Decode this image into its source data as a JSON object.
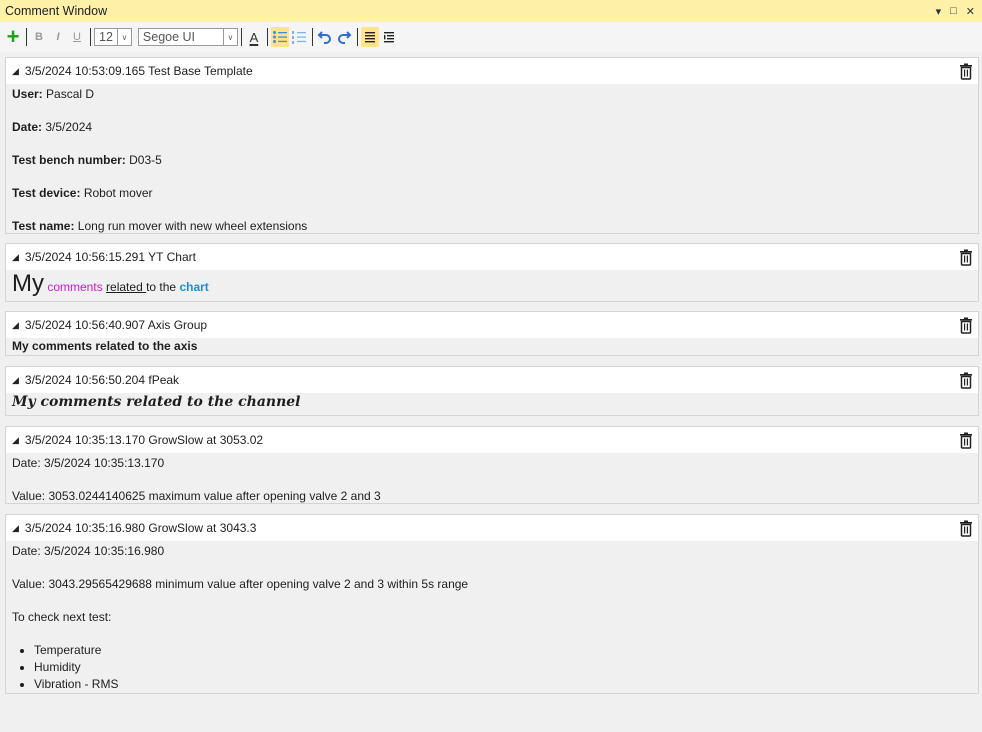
{
  "window": {
    "title": "Comment Window",
    "menu_glyph": "▾",
    "restore_glyph": "□",
    "close_glyph": "✕"
  },
  "toolbar": {
    "add": "+",
    "bold": "B",
    "italic": "I",
    "underline": "U",
    "font_size": "12",
    "font_family": "Segoe UI",
    "font_color": "A",
    "dropdown_glyph": "∨"
  },
  "comments": [
    {
      "header": "3/5/2024 10:53:09.165 Test Base Template",
      "fields": [
        {
          "label": "User:",
          "value": " Pascal D"
        },
        {
          "label": "Date:",
          "value": " 3/5/2024"
        },
        {
          "label": "Test bench number:",
          "value": " D03-5"
        },
        {
          "label": "Test device:",
          "value": " Robot mover"
        },
        {
          "label": "Test name:",
          "value": " Long run mover with new wheel extensions"
        }
      ]
    },
    {
      "header": "3/5/2024 10:56:15.291 YT Chart",
      "rich": {
        "big": "My",
        "comments": "comments",
        "related": "related ",
        "to_the": "to the ",
        "chart": "chart"
      }
    },
    {
      "header": "3/5/2024 10:56:40.907 Axis Group",
      "text": "My comments related to the axis"
    },
    {
      "header": "3/5/2024 10:56:50.204 fPeak",
      "text": "My comments related to the channel"
    },
    {
      "header": "3/5/2024 10:35:13.170 GrowSlow at 3053.02",
      "lines": [
        "Date: 3/5/2024 10:35:13.170",
        "Value: 3053.0244140625 maximum value after opening valve 2 and 3"
      ]
    },
    {
      "header": "3/5/2024 10:35:16.980 GrowSlow at 3043.3",
      "lines": [
        "Date: 3/5/2024 10:35:16.980",
        "Value: 3043.29565429688 minimum value after opening valve 2 and 3 within 5s range",
        "To check next test:"
      ],
      "bullets": [
        "Temperature",
        "Humidity",
        "Vibration - RMS"
      ]
    }
  ]
}
